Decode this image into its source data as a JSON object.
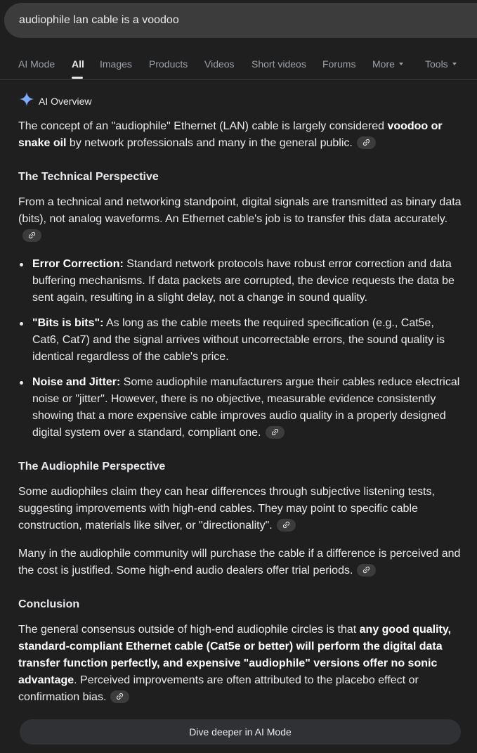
{
  "search": {
    "query": "audiophile lan cable is a voodoo"
  },
  "tabs": [
    {
      "label": "AI Mode"
    },
    {
      "label": "All"
    },
    {
      "label": "Images"
    },
    {
      "label": "Products"
    },
    {
      "label": "Videos"
    },
    {
      "label": "Short videos"
    },
    {
      "label": "Forums"
    },
    {
      "label": "More"
    },
    {
      "label": "Tools"
    }
  ],
  "overview": {
    "label": "AI Overview",
    "intro": {
      "a": "The concept of an \"audiophile\" Ethernet (LAN) cable is largely considered ",
      "b": "voodoo or snake oil",
      "c": " by network professionals and many in the general public."
    },
    "technical": {
      "heading": "The Technical Perspective",
      "para": "From a technical and networking standpoint, digital signals are transmitted as binary data (bits), not analog waveforms. An Ethernet cable's job is to transfer this data accurately.",
      "bullets": [
        {
          "title": "Error Correction:",
          "text": " Standard network protocols have robust error correction and data buffering mechanisms. If data packets are corrupted, the device requests the data be sent again, resulting in a slight delay, not a change in sound quality."
        },
        {
          "title": "\"Bits is bits\":",
          "text": " As long as the cable meets the required specification (e.g., Cat5e, Cat6, Cat7) and the signal arrives without uncorrectable errors, the sound quality is identical regardless of the cable's price."
        },
        {
          "title": "Noise and Jitter:",
          "text": " Some audiophile manufacturers argue their cables reduce electrical noise or \"jitter\". However, there is no objective, measurable evidence consistently showing that a more expensive cable improves audio quality in a properly designed digital system over a standard, compliant one."
        }
      ]
    },
    "audiophile": {
      "heading": "The Audiophile Perspective",
      "para1": "Some audiophiles claim they can hear differences through subjective listening tests, suggesting improvements with high-end cables. They may point to specific cable construction, materials like silver, or \"directionality\".",
      "para2": "Many in the audiophile community will purchase the cable if a difference is perceived and the cost is justified. Some high-end audio dealers offer trial periods."
    },
    "conclusion": {
      "heading": "Conclusion",
      "a": "The general consensus outside of high-end audiophile circles is that ",
      "b": "any good quality, standard-compliant Ethernet cable (Cat5e or better) will perform the digital data transfer function perfectly, and expensive \"audiophile\" versions offer no sonic advantage",
      "c": ". Perceived improvements are often attributed to the placebo effect or confirmation bias."
    }
  },
  "dive_button": {
    "label": "Dive deeper in AI Mode"
  },
  "colors": {
    "background": "#1f1f1f",
    "search_bg": "#3c3c3c",
    "text": "#e8eaed",
    "muted": "#9aa0a6",
    "sparkle": "#7cacf8"
  },
  "icons": {
    "ai": "sparkle-icon",
    "citation": "link-icon",
    "dropdown": "caret-down-icon"
  }
}
